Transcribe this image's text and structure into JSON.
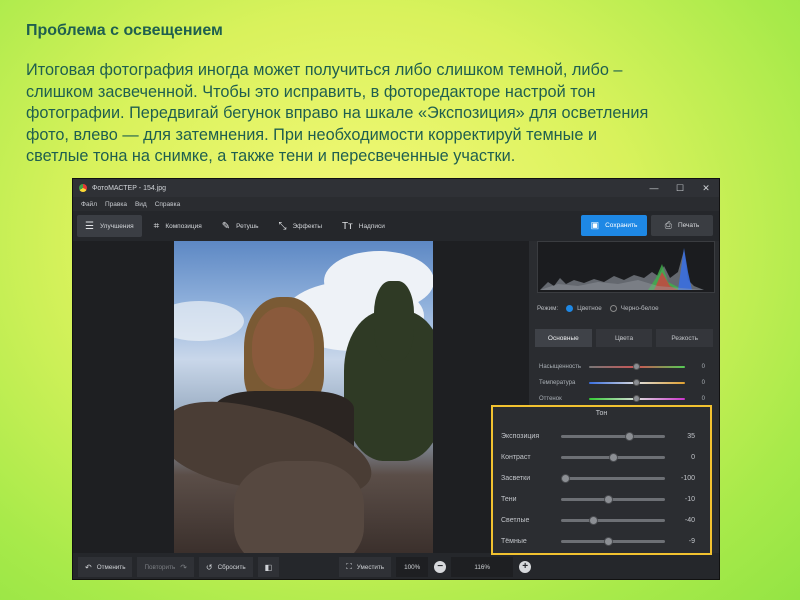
{
  "slide": {
    "title": "Проблема с освещением",
    "body_lines": [
      "Итоговая фотография иногда может получиться либо слишком темной, либо –",
      "слишком засвеченной. Чтобы это исправить, в фоторедакторе настрой тон",
      "фотографии. Передвигай бегунок вправо на шкале «Экспозиция» для осветления",
      "фото, влево — для затемнения. При необходимости корректируй темные и",
      "светлые тона на снимке, а также тени и пересвеченные участки."
    ]
  },
  "app": {
    "window_title": "ФотоМАСТЕР - 154.jpg",
    "window_controls": [
      "—",
      "☐",
      "✕"
    ],
    "menu": [
      "Файл",
      "Правка",
      "Вид",
      "Справка"
    ],
    "tools": [
      {
        "label": "Улучшения",
        "icon": "sliders-icon",
        "glyph": "☰"
      },
      {
        "label": "Композиция",
        "icon": "crop-icon",
        "glyph": "⌗"
      },
      {
        "label": "Ретушь",
        "icon": "brush-icon",
        "glyph": "✎"
      },
      {
        "label": "Эффекты",
        "icon": "magic-wand-icon",
        "glyph": "⤡"
      },
      {
        "label": "Надписи",
        "icon": "text-icon",
        "glyph": "Tт"
      }
    ],
    "save_label": "Сохранить",
    "print_label": "Печать",
    "mode_label": "Режим:",
    "mode_options": [
      "Цветное",
      "Черно-белое"
    ],
    "subtabs": [
      "Основные",
      "Цвета",
      "Резкость"
    ],
    "color_sliders": [
      {
        "label": "Насыщенность",
        "value": "0"
      },
      {
        "label": "Температура",
        "value": "0"
      },
      {
        "label": "Оттенок",
        "value": "0"
      }
    ],
    "bottom": {
      "undo": "Отменить",
      "redo": "Повторить",
      "reset": "Сбросить",
      "fit": "Уместить",
      "zoom_100": "100%",
      "zoom_current": "116%"
    }
  },
  "tone": {
    "title": "Тон",
    "sliders": [
      {
        "label": "Экспозиция",
        "value": "35"
      },
      {
        "label": "Контраст",
        "value": "0"
      },
      {
        "label": "Засветки",
        "value": "-100"
      },
      {
        "label": "Тени",
        "value": "-10"
      },
      {
        "label": "Светлые",
        "value": "-40"
      },
      {
        "label": "Тёмные",
        "value": "-9"
      }
    ]
  }
}
